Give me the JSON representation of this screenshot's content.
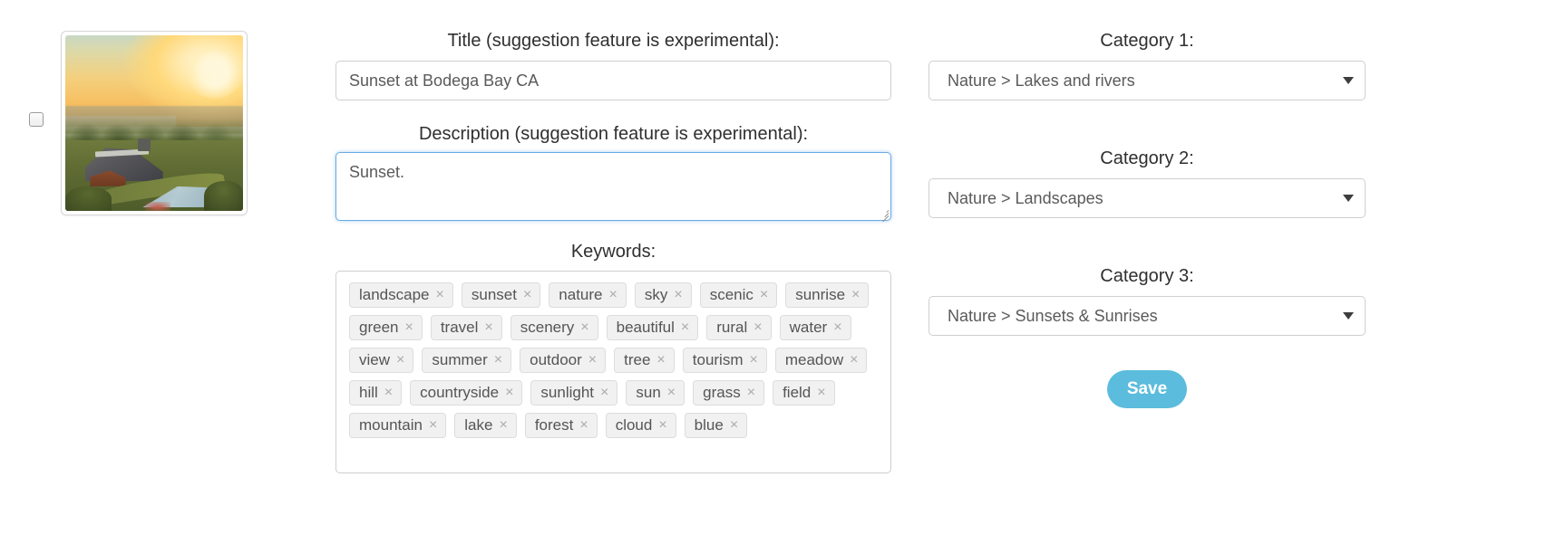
{
  "thumbnail": {
    "alt": "Sunset over coastal town with buildings, trees and a pool"
  },
  "form": {
    "title": {
      "label": "Title (suggestion feature is experimental):",
      "value": "Sunset at Bodega Bay CA",
      "placeholder": ""
    },
    "description": {
      "label": "Description (suggestion feature is experimental):",
      "value": "Sunset.",
      "placeholder": ""
    },
    "keywords": {
      "label": "Keywords:",
      "remove_glyph": "×",
      "items": [
        "landscape",
        "sunset",
        "nature",
        "sky",
        "scenic",
        "sunrise",
        "green",
        "travel",
        "scenery",
        "beautiful",
        "rural",
        "water",
        "view",
        "summer",
        "outdoor",
        "tree",
        "tourism",
        "meadow",
        "hill",
        "countryside",
        "sunlight",
        "sun",
        "grass",
        "field",
        "mountain",
        "lake",
        "forest",
        "cloud",
        "blue"
      ]
    },
    "categories": [
      {
        "label": "Category 1:",
        "value": "Nature > Lakes and rivers"
      },
      {
        "label": "Category 2:",
        "value": "Nature > Landscapes"
      },
      {
        "label": "Category 3:",
        "value": "Nature > Sunsets & Sunrises"
      }
    ],
    "save_label": "Save"
  },
  "colors": {
    "accent": "#5bbcdd",
    "focus_border": "#6aaae4",
    "field_border": "#cfcfcf",
    "chip_bg": "#f1f1f1",
    "text": "#2f2f2f"
  }
}
